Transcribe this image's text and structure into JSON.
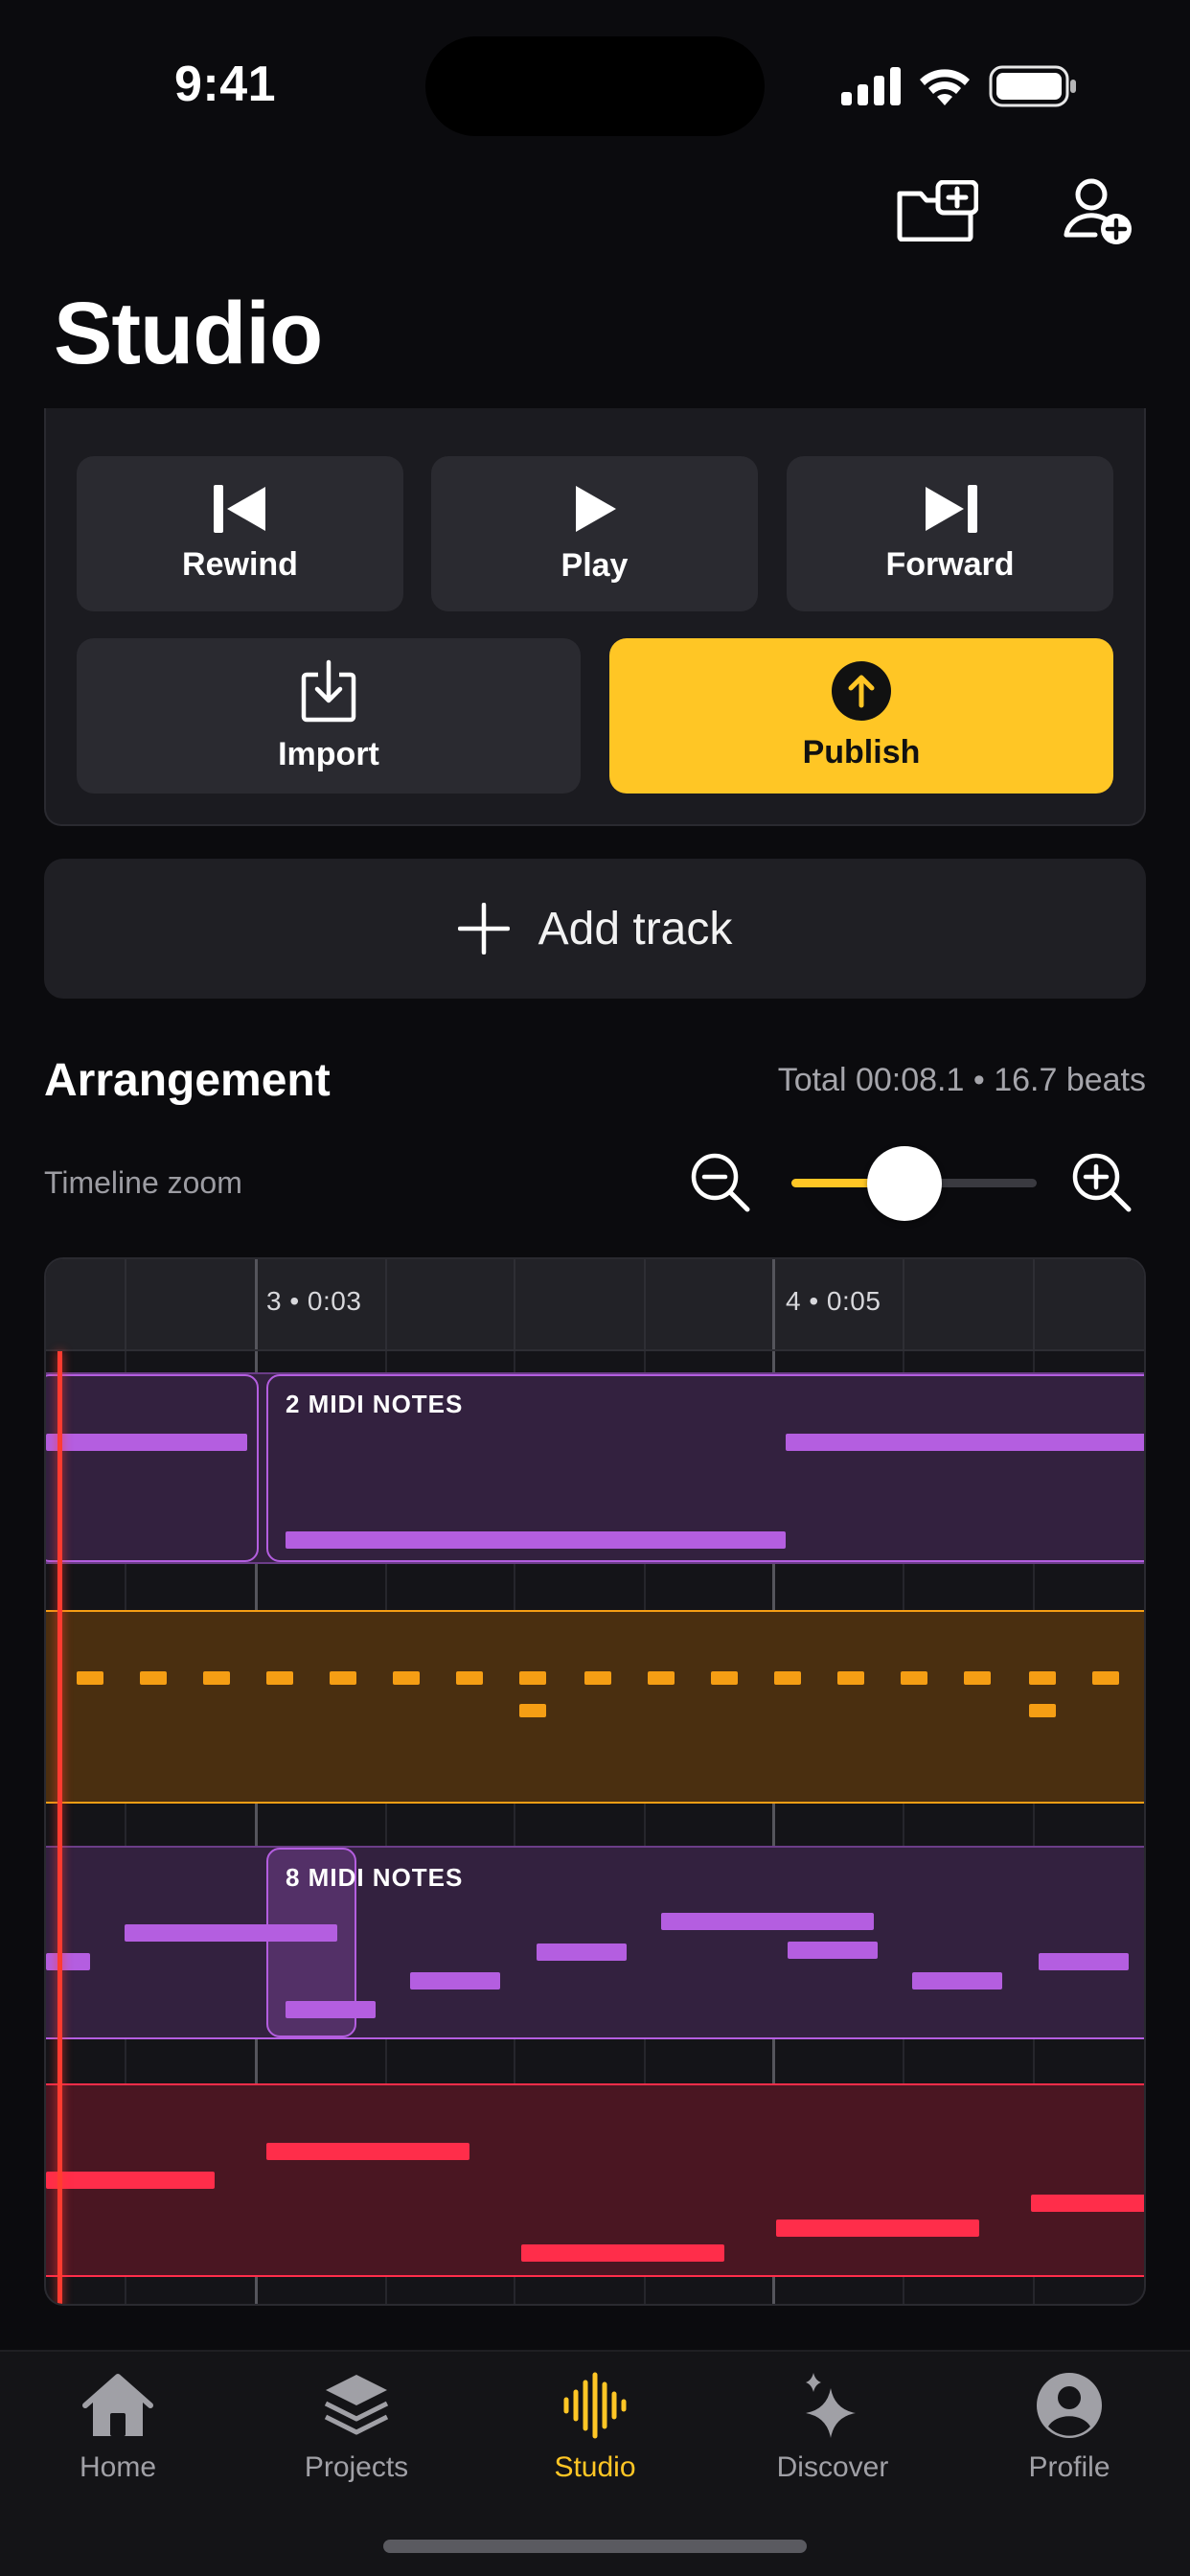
{
  "status": {
    "time": "9:41"
  },
  "header": {
    "title": "Studio",
    "new_folder_icon": "folder-plus-icon",
    "add_user_icon": "user-plus-icon"
  },
  "transport": {
    "rewind": "Rewind",
    "play": "Play",
    "forward": "Forward",
    "import": "Import",
    "publish": "Publish"
  },
  "add_track": {
    "label": "Add track"
  },
  "arrangement": {
    "title": "Arrangement",
    "total": "Total 00:08.1 • 16.7 beats",
    "zoom_label": "Timeline zoom",
    "zoom_level": 0.46
  },
  "ruler": {
    "mark1": "3 • 0:03",
    "mark2": "4 • 0:05"
  },
  "tracks": {
    "track1_clip_label": "2 MIDI NOTES",
    "track3_clip_label": "8 MIDI NOTES"
  },
  "colors": {
    "accent": "#ffc625",
    "purple": "#b45ee0",
    "orange": "#f59e14",
    "red": "#ff2d4a",
    "playhead": "#ff3b30"
  },
  "tabbar": {
    "items": [
      {
        "label": "Home",
        "icon": "house-icon"
      },
      {
        "label": "Projects",
        "icon": "layers-icon"
      },
      {
        "label": "Studio",
        "icon": "waveform-icon",
        "active": true
      },
      {
        "label": "Discover",
        "icon": "sparkles-icon"
      },
      {
        "label": "Profile",
        "icon": "person-circle-icon"
      }
    ]
  }
}
